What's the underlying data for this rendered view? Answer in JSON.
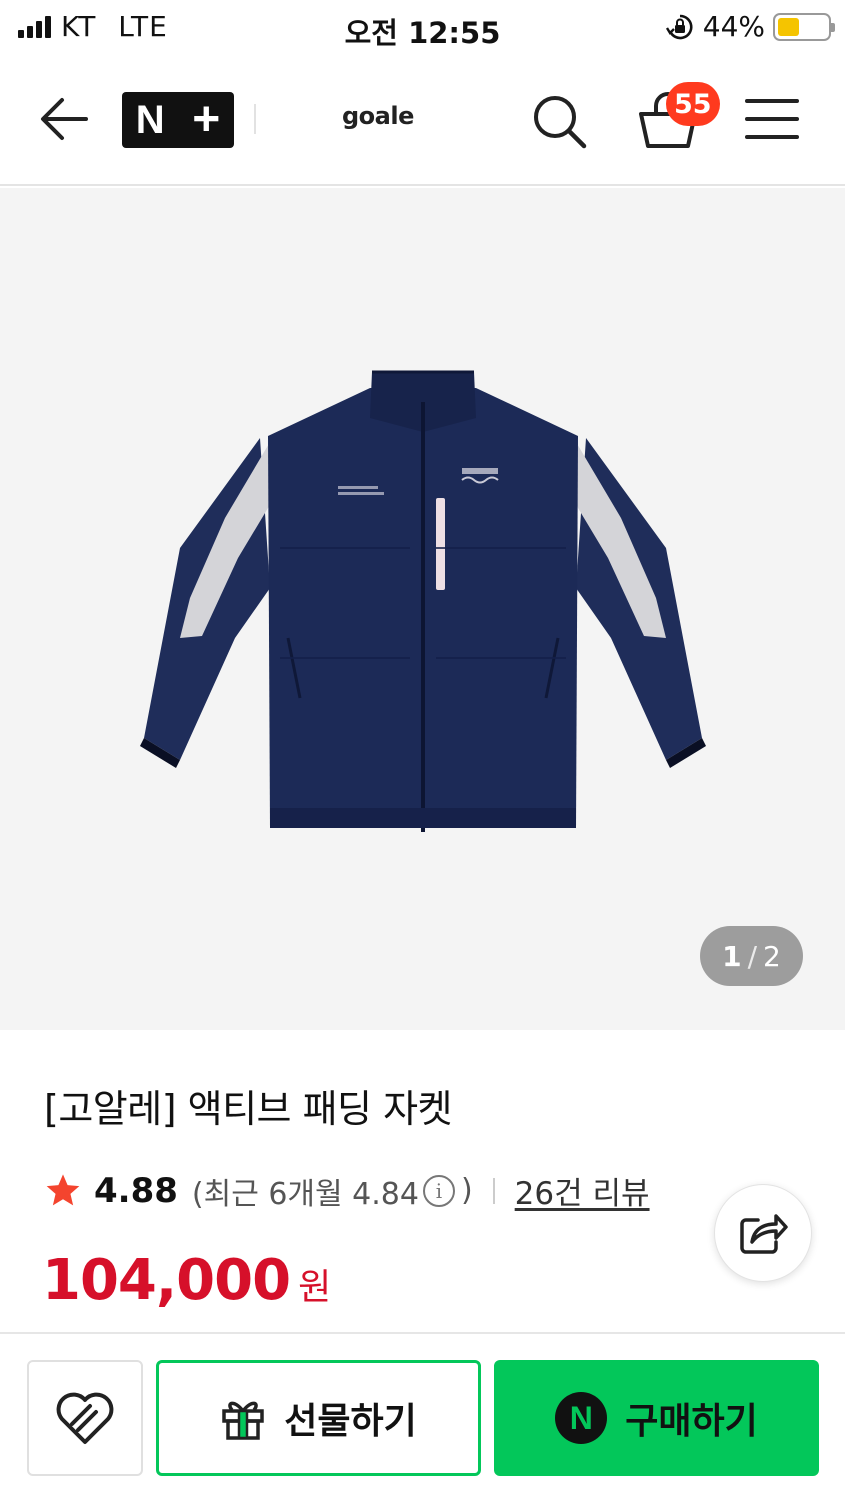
{
  "status_bar": {
    "carrier": "KT",
    "network": "LTE",
    "time": "오전 12:55",
    "battery": "44%",
    "battery_level": 0.44,
    "signal_icon": "signal-bars-icon",
    "orientation_lock_icon": "orientation-lock-icon"
  },
  "header": {
    "back_icon": "arrow-left-icon",
    "logo_n": "N",
    "logo_plus": "+",
    "brand": "goale",
    "search_icon": "search-icon",
    "cart_icon": "shopping-bag-icon",
    "cart_count": "55",
    "menu_icon": "hamburger-menu-icon"
  },
  "gallery": {
    "current_page": "1",
    "separator": "/",
    "total_pages": "2",
    "image_subject": "navy padded jacket"
  },
  "product": {
    "title": "[고알레] 액티브 패딩 자켓",
    "rating": "4.88",
    "recent_open": "(최근 6개월 4.84",
    "recent_close": ")",
    "info_icon_glyph": "i",
    "reviews": "26건 리뷰",
    "price": "104,000",
    "currency": "원",
    "star_color": "#f4442e",
    "price_color": "#d6102a"
  },
  "actions": {
    "wishlist_icon": "heart-icon",
    "gift_icon": "gift-icon",
    "gift_label": "선물하기",
    "npay_glyph": "N",
    "buy_label": "구매하기",
    "accent_color": "#03c75a"
  }
}
